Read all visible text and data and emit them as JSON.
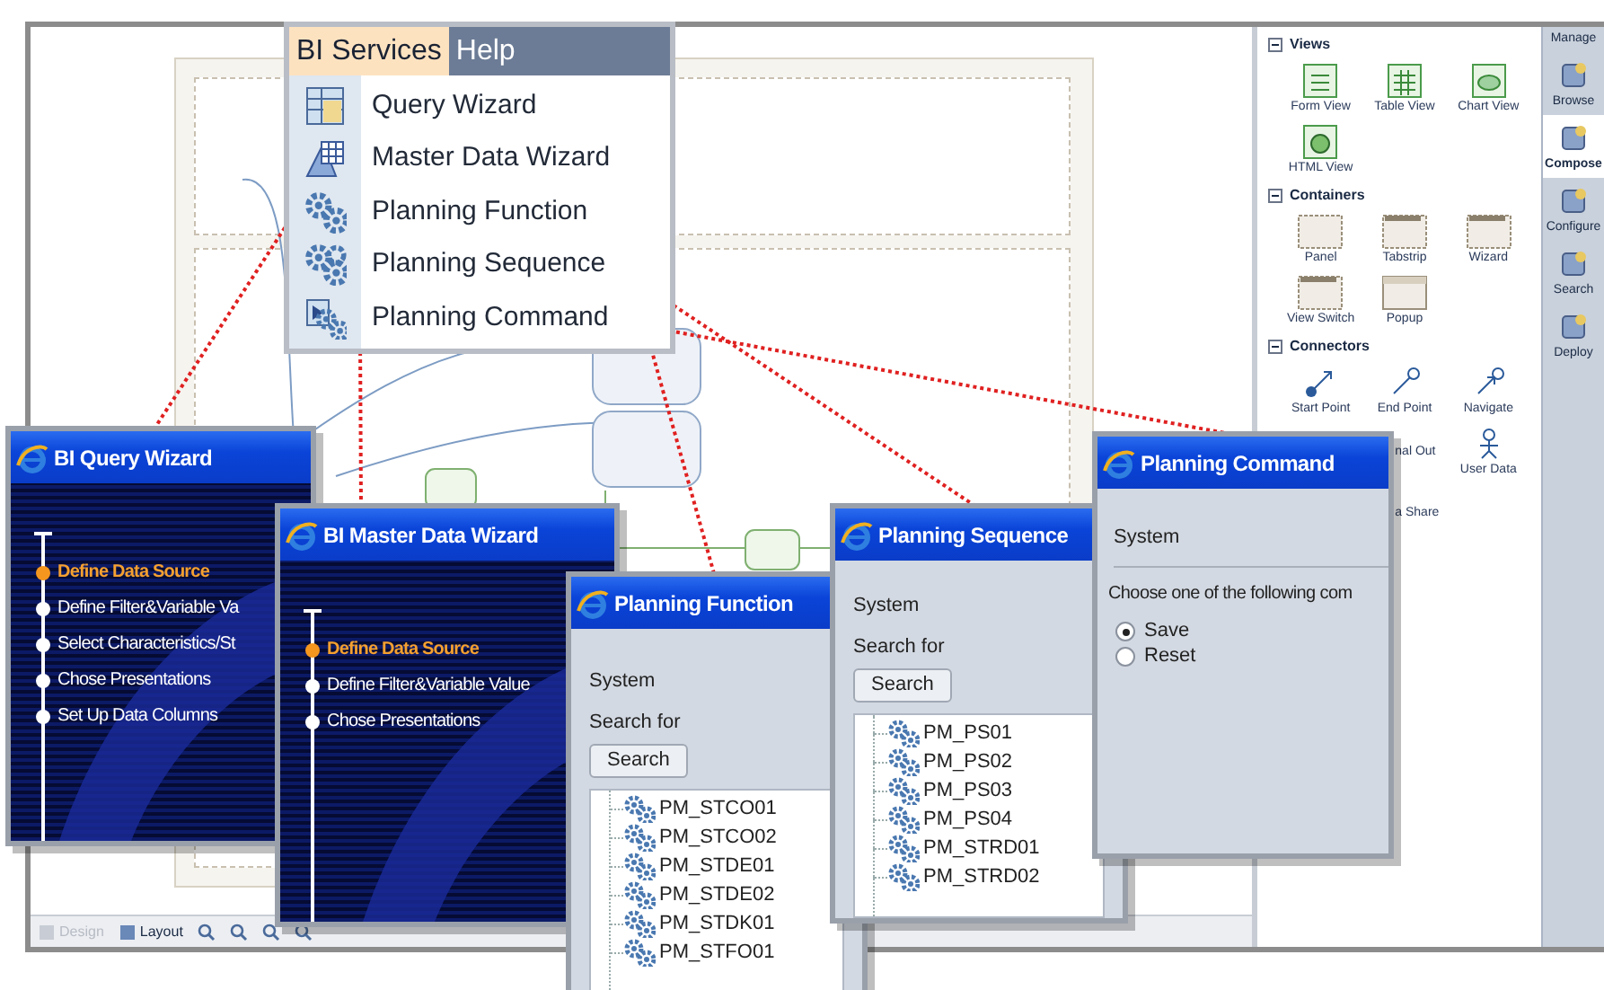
{
  "menu": {
    "bar": [
      {
        "label": "BI Services",
        "selected": true
      },
      {
        "label": "Help",
        "selected": false
      }
    ],
    "entries": [
      {
        "label": "Query Wizard"
      },
      {
        "label": "Master Data Wizard"
      },
      {
        "label": "Planning Function"
      },
      {
        "label": "Planning Sequence"
      },
      {
        "label": "Planning Command"
      }
    ]
  },
  "palette": {
    "sections": [
      {
        "title": "Views",
        "expanded": true,
        "items": [
          {
            "label": "Form View",
            "clipped": false
          },
          {
            "label": "Table View",
            "clipped": false
          },
          {
            "label": "Chart View",
            "clipped": false
          },
          {
            "label": "HTML View",
            "clipped": false
          }
        ]
      },
      {
        "title": "Containers",
        "expanded": true,
        "items": [
          {
            "label": "Panel",
            "clipped": false
          },
          {
            "label": "Tabstrip",
            "clipped": false
          },
          {
            "label": "Wizard",
            "clipped": false
          },
          {
            "label": "View Switch",
            "clipped": false
          },
          {
            "label": "Popup",
            "clipped": false
          }
        ]
      },
      {
        "title": "Connectors",
        "expanded": true,
        "items": [
          {
            "label": "Start Point",
            "clipped": false
          },
          {
            "label": "End Point",
            "clipped": false
          },
          {
            "label": "Navigate",
            "clipped": false
          },
          {
            "label": "nal Out",
            "clipped": true
          },
          {
            "label": "User Data",
            "clipped": false
          },
          {
            "label": "a Share",
            "clipped": true
          }
        ]
      }
    ]
  },
  "nav": {
    "title": "Manage",
    "items": [
      {
        "label": "Browse",
        "selected": false
      },
      {
        "label": "Compose",
        "selected": true
      },
      {
        "label": "Configure",
        "selected": false
      },
      {
        "label": "Search",
        "selected": false
      },
      {
        "label": "Deploy",
        "selected": false
      }
    ]
  },
  "toolbar": {
    "items": [
      {
        "label": "Design",
        "disabled": true
      },
      {
        "label": "Layout",
        "disabled": false
      }
    ]
  },
  "windows": [
    {
      "kind": "wizard",
      "title": "BI Query Wizard",
      "steps": [
        {
          "label": "Define Data Source",
          "selected": true
        },
        {
          "label": "Define Filter&Variable Va",
          "selected": false
        },
        {
          "label": "Select Characteristics/St",
          "selected": false
        },
        {
          "label": "Chose Presentations",
          "selected": false
        },
        {
          "label": "Set Up Data Columns",
          "selected": false
        }
      ]
    },
    {
      "kind": "wizard",
      "title": "BI Master Data Wizard",
      "steps": [
        {
          "label": "Define Data Source",
          "selected": true
        },
        {
          "label": "Define Filter&Variable Value",
          "selected": false
        },
        {
          "label": "Chose Presentations",
          "selected": false
        }
      ]
    },
    {
      "kind": "search",
      "title": "Planning Function",
      "system_label": "System",
      "search_label": "Search for",
      "button": "Search",
      "results": [
        "PM_STCO01",
        "PM_STCO02",
        "PM_STDE01",
        "PM_STDE02",
        "PM_STDK01",
        "PM_STFO01"
      ]
    },
    {
      "kind": "search",
      "title": "Planning Sequence",
      "system_label": "System",
      "search_label": "Search for",
      "button": "Search",
      "results": [
        "PM_PS01",
        "PM_PS02",
        "PM_PS03",
        "PM_PS04",
        "PM_STRD01",
        "PM_STRD02"
      ]
    },
    {
      "kind": "command",
      "title": "Planning Command",
      "system_label": "System",
      "prompt": "Choose one of the following com",
      "options": [
        {
          "label": "Save",
          "selected": true
        },
        {
          "label": "Reset",
          "selected": false
        }
      ]
    }
  ]
}
